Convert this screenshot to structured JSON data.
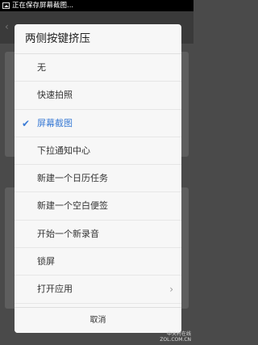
{
  "status_bar": {
    "notification_text": "正在保存屏幕截图..."
  },
  "dialog": {
    "title": "两侧按键挤压",
    "options": [
      {
        "label": "无",
        "selected": false
      },
      {
        "label": "快速拍照",
        "selected": false
      },
      {
        "label": "屏幕截图",
        "selected": true
      },
      {
        "label": "下拉通知中心",
        "selected": false
      },
      {
        "label": "新建一个日历任务",
        "selected": false
      },
      {
        "label": "新建一个空白便签",
        "selected": false
      },
      {
        "label": "开始一个新录音",
        "selected": false
      },
      {
        "label": "锁屏",
        "selected": false
      },
      {
        "label": "打开应用",
        "selected": false,
        "has_submenu": true
      }
    ],
    "cancel_label": "取消"
  },
  "watermark": {
    "line1": "中关村在线",
    "line2": "ZOL.COM.CN"
  },
  "colors": {
    "accent": "#3a7bd5",
    "dialog_bg": "#f7f7f7",
    "scrim": "#4a4a4a"
  }
}
